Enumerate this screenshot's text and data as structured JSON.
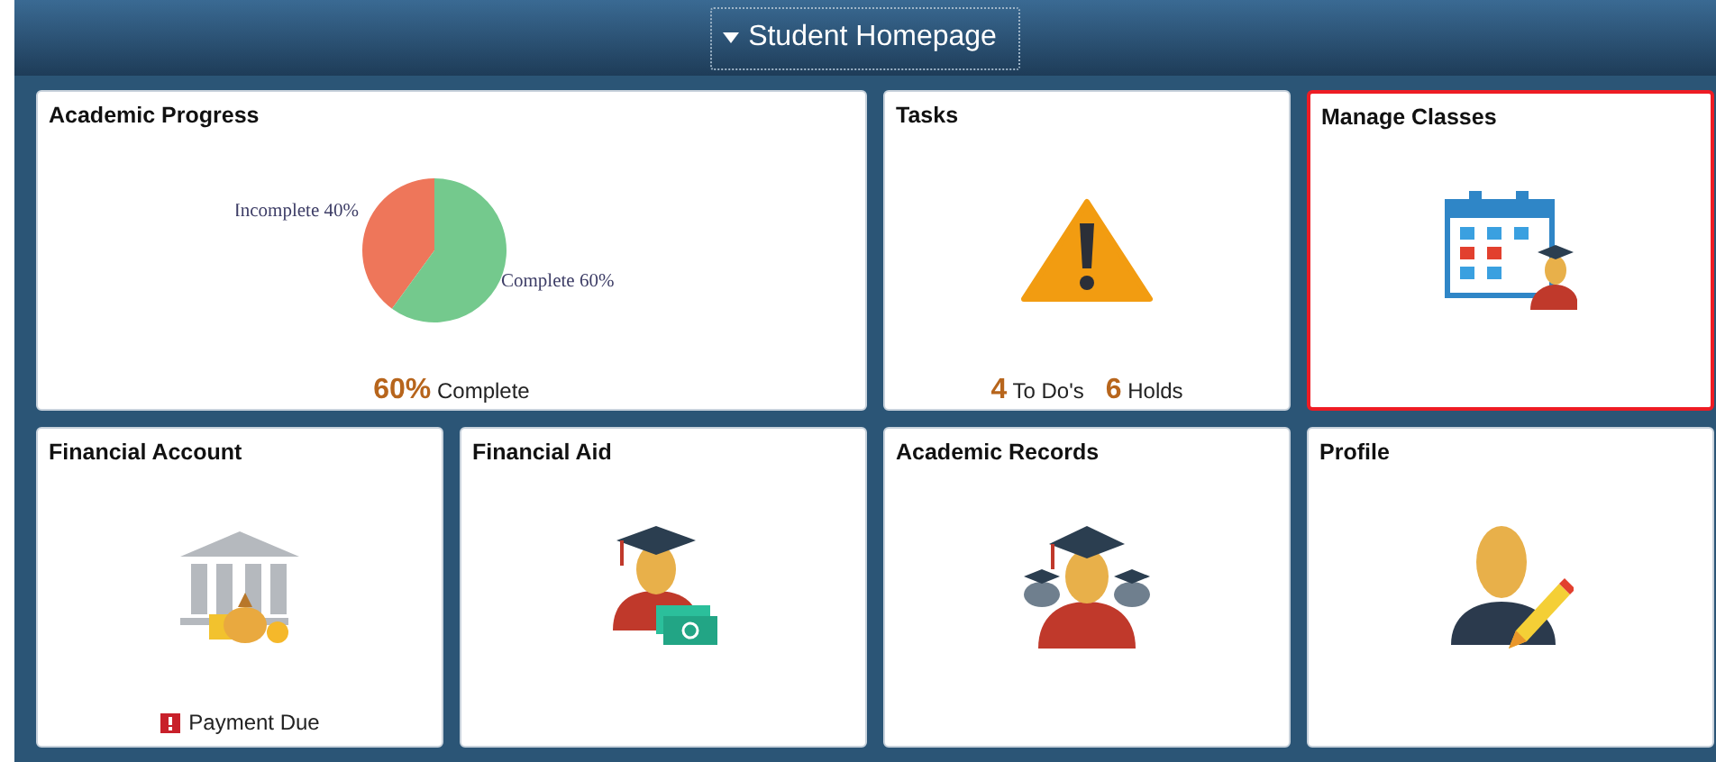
{
  "header": {
    "title": "Student Homepage"
  },
  "tiles": [
    {
      "title": "Academic Progress",
      "kind": "chart",
      "selected": false,
      "chart_data": {
        "type": "pie",
        "categories": [
          "Incomplete",
          "Complete"
        ],
        "values": [
          40,
          60
        ],
        "data_labels": true,
        "value_labels": [
          "40%",
          "60%"
        ]
      },
      "footer": [
        {
          "count": "60%",
          "text": "Complete"
        }
      ]
    },
    {
      "title": "Tasks",
      "kind": "tasks",
      "selected": false,
      "footer": [
        {
          "count": "4",
          "text": "To Do's"
        },
        {
          "count": "6",
          "text": "Holds"
        }
      ]
    },
    {
      "title": "Manage Classes",
      "kind": "calendar",
      "selected": true
    },
    {
      "title": "Financial Account",
      "kind": "bank",
      "selected": false,
      "alert": "Payment Due"
    },
    {
      "title": "Financial Aid",
      "kind": "aid",
      "selected": false
    },
    {
      "title": "Academic Records",
      "kind": "records",
      "selected": false
    },
    {
      "title": "Profile",
      "kind": "profile",
      "selected": false
    }
  ]
}
